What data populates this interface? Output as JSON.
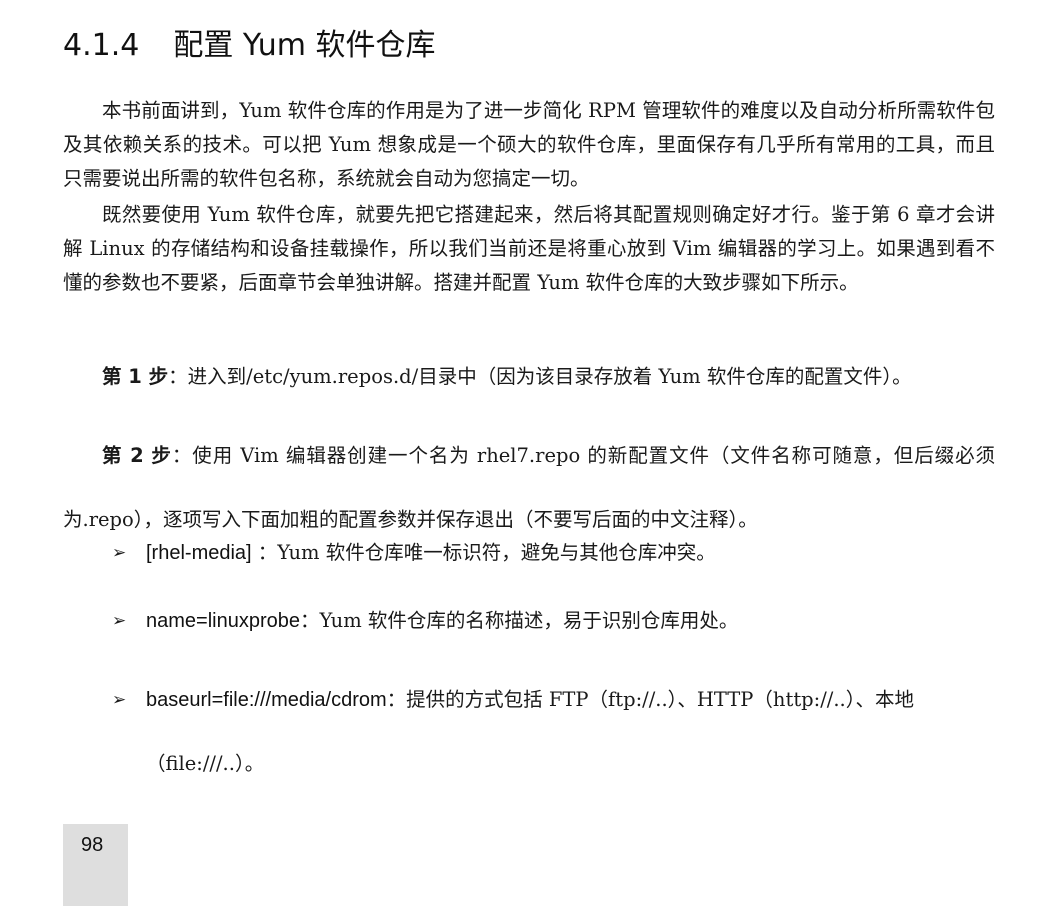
{
  "section": {
    "number": "4.1.4",
    "title": "配置 Yum 软件仓库"
  },
  "paragraphs": [
    "本书前面讲到，Yum 软件仓库的作用是为了进一步简化 RPM 管理软件的难度以及自动分析所需软件包及其依赖关系的技术。可以把 Yum 想象成是一个硕大的软件仓库，里面保存有几乎所有常用的工具，而且只需要说出所需的软件包名称，系统就会自动为您搞定一切。",
    "既然要使用 Yum 软件仓库，就要先把它搭建起来，然后将其配置规则确定好才行。鉴于第 6 章才会讲解 Linux 的存储结构和设备挂载操作，所以我们当前还是将重心放到 Vim 编辑器的学习上。如果遇到看不懂的参数也不要紧，后面章节会单独讲解。搭建并配置 Yum 软件仓库的大致步骤如下所示。"
  ],
  "steps": [
    {
      "label": "第 1 步",
      "text": "：进入到/etc/yum.repos.d/目录中（因为该目录存放着 Yum 软件仓库的配置文件）。"
    },
    {
      "label": "第 2 步",
      "text": "：使用 Vim 编辑器创建一个名为 rhel7.repo 的新配置文件（文件名称可随意，但后缀必须为.repo），逐项写入下面加粗的配置参数并保存退出（不要写后面的中文注释）。"
    }
  ],
  "bullets": [
    {
      "marker": "➢",
      "code": "[rhel-media]",
      "text": " ：Yum 软件仓库唯一标识符，避免与其他仓库冲突。"
    },
    {
      "marker": "➢",
      "code": "name=linuxprobe",
      "text": "：Yum 软件仓库的名称描述，易于识别仓库用处。"
    },
    {
      "marker": "➢",
      "code": "baseurl=file:///media/cdrom",
      "text": "：提供的方式包括 FTP（ftp://..）、HTTP（http://..）、本地（file:///..）。"
    }
  ],
  "footer": {
    "page_number": "98"
  }
}
